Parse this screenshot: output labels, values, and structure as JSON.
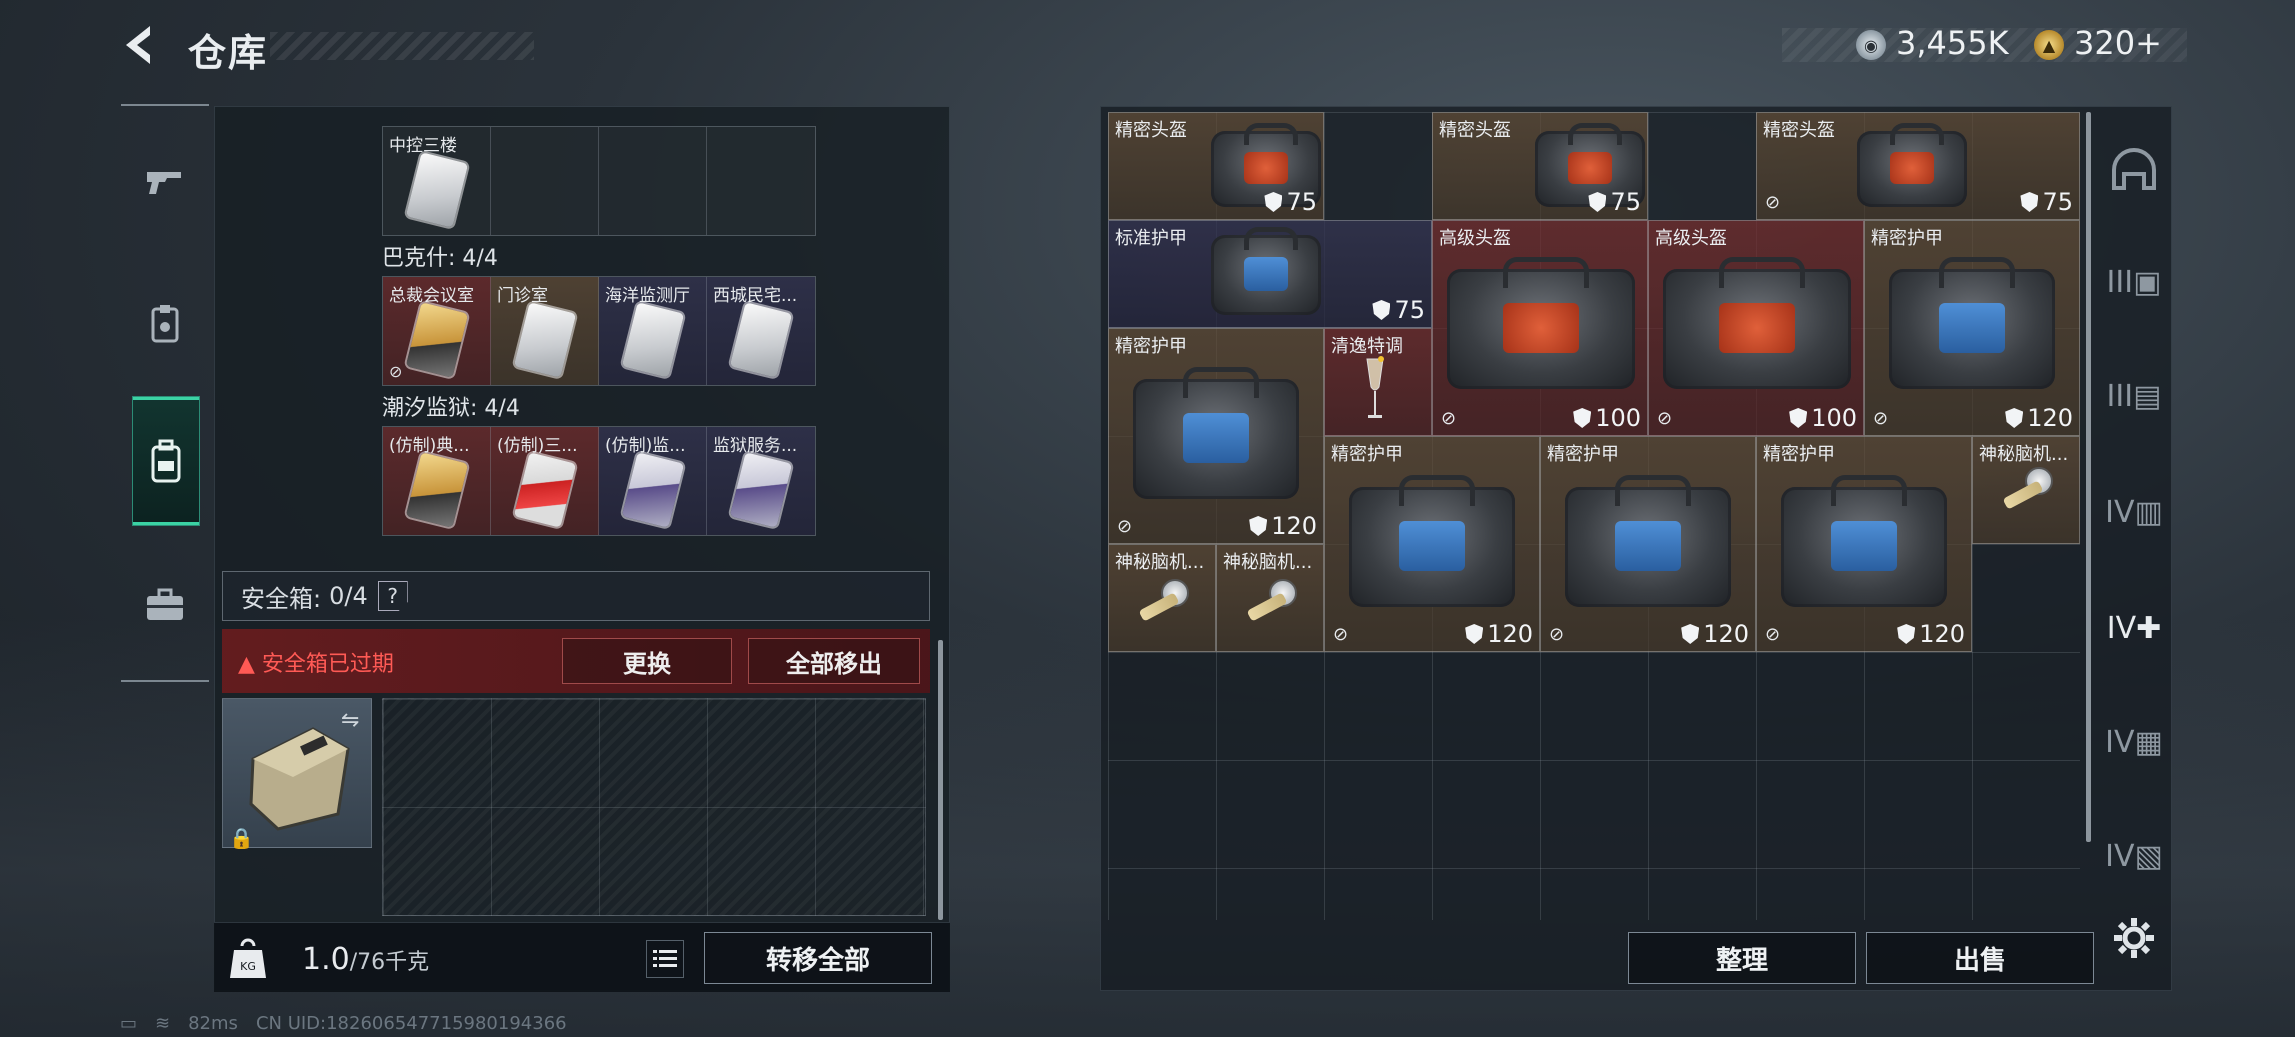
{
  "header": {
    "title": "仓库",
    "silver_amount": "3,455K",
    "gold_amount": "320+"
  },
  "left_nav": [
    {
      "name": "weapon",
      "icon": "gun-icon"
    },
    {
      "name": "keycard",
      "icon": "keycard-icon"
    },
    {
      "name": "inventory",
      "icon": "backpack-icon",
      "active": true
    },
    {
      "name": "case",
      "icon": "briefcase-icon"
    }
  ],
  "keycard_groups": [
    {
      "label": "巴克什: 4/4",
      "slots": [
        {
          "label": "总裁会议室",
          "color": "gold",
          "bg": "red",
          "nobind": true
        },
        {
          "label": "门诊室",
          "color": "white",
          "bg": "brown"
        },
        {
          "label": "海洋监测厅",
          "color": "white",
          "bg": "navy"
        },
        {
          "label": "西城民宅...",
          "color": "white",
          "bg": "navy"
        }
      ]
    },
    {
      "label": "潮汐监狱: 4/4",
      "slots": [
        {
          "label": "(仿制)典...",
          "color": "gold",
          "bg": "red"
        },
        {
          "label": "(仿制)三...",
          "color": "red",
          "bg": "red"
        },
        {
          "label": "(仿制)监...",
          "color": "purple",
          "bg": "navy"
        },
        {
          "label": "监狱服务...",
          "color": "purple",
          "bg": "navy"
        }
      ]
    }
  ],
  "top_partial": {
    "first_slot_label": "中控三楼"
  },
  "safe": {
    "label": "安全箱:",
    "count": "0/4",
    "help": "?",
    "warning": "安全箱已过期",
    "replace_btn": "更换",
    "remove_all_btn": "全部移出"
  },
  "bottom_left": {
    "weight": "1.0",
    "weight_max": "/76千克",
    "transfer_all": "转移全部"
  },
  "status_bar": {
    "ping": "82ms",
    "uid": "CN UID:1826065477159801943​66"
  },
  "stash_items": [
    {
      "label": "精密头盔",
      "dur": "75",
      "kind": "helmet",
      "nobind": false
    },
    {
      "label": "精密头盔",
      "dur": "75",
      "kind": "helmet",
      "nobind": false
    },
    {
      "label": "精密头盔",
      "dur": "75",
      "kind": "helmet",
      "nobind": true
    },
    {
      "label": "标准护甲",
      "dur": "75",
      "kind": "armor",
      "nobind": false
    },
    {
      "label": "高级头盔",
      "dur": "100",
      "kind": "helmet",
      "nobind": true
    },
    {
      "label": "高级头盔",
      "dur": "100",
      "kind": "helmet",
      "nobind": true
    },
    {
      "label": "精密护甲",
      "dur": "120",
      "kind": "armor",
      "nobind": true
    },
    {
      "label": "精密护甲",
      "dur": "120",
      "kind": "armor",
      "nobind": true
    },
    {
      "label": "清逸特调",
      "dur": "",
      "kind": "drink",
      "nobind": false
    },
    {
      "label": "精密护甲",
      "dur": "120",
      "kind": "armor",
      "nobind": true
    },
    {
      "label": "精密护甲",
      "dur": "120",
      "kind": "armor",
      "nobind": true
    },
    {
      "label": "精密护甲",
      "dur": "120",
      "kind": "armor",
      "nobind": true
    },
    {
      "label": "神秘脑机...",
      "dur": "",
      "kind": "brain",
      "nobind": false
    },
    {
      "label": "神秘脑机...",
      "dur": "",
      "kind": "brain",
      "nobind": false
    },
    {
      "label": "神秘脑机...",
      "dur": "",
      "kind": "brain",
      "nobind": false
    }
  ],
  "right_buttons": {
    "sort": "整理",
    "sell": "出售"
  },
  "right_side_icons": [
    {
      "icon": "helmet-icon",
      "label": ""
    },
    {
      "icon": "armor-tier3-icon",
      "label": "III"
    },
    {
      "icon": "armor-tier3b-icon",
      "label": "III"
    },
    {
      "icon": "armor-tier4-icon",
      "label": "IV"
    },
    {
      "icon": "add-armor-icon",
      "label": "IV"
    },
    {
      "icon": "armor-tier4b-icon",
      "label": "IV"
    },
    {
      "icon": "armor-tier4c-icon",
      "label": "IV"
    }
  ]
}
